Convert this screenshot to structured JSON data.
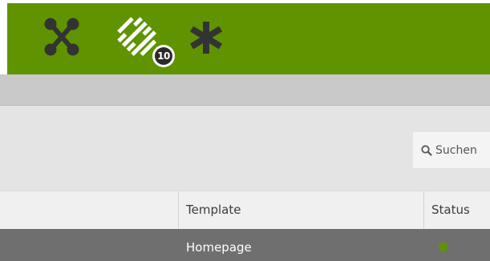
{
  "toolbar": {
    "background": "#5f9400",
    "icons": [
      {
        "name": "nodes-icon",
        "color": "#333333"
      },
      {
        "name": "tiles-icon",
        "color": "#ffffff",
        "badge": "10"
      },
      {
        "name": "asterisk-icon",
        "color": "#333333"
      }
    ]
  },
  "search": {
    "placeholder": "Suchen",
    "value": ""
  },
  "table": {
    "columns": [
      "Template",
      "Status"
    ],
    "rows": [
      {
        "template": "Homepage",
        "status": "active",
        "status_color": "#5f9400"
      }
    ]
  }
}
